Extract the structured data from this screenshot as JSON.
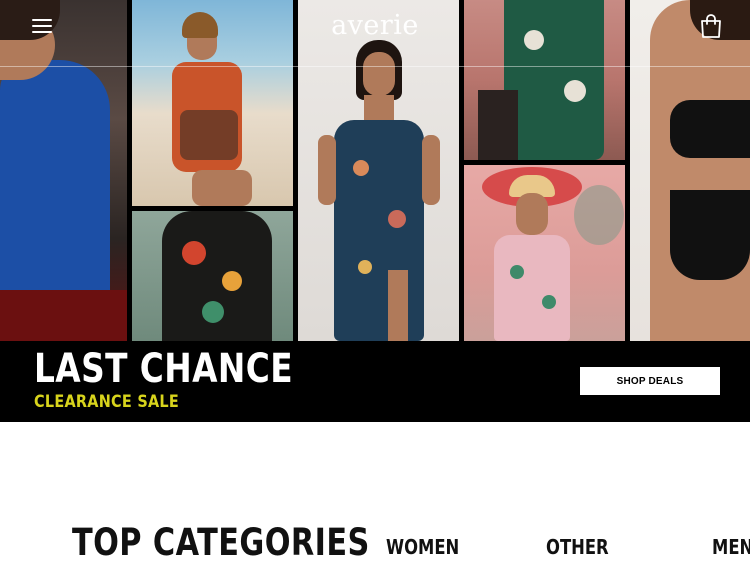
{
  "header": {
    "logo_text": "averie",
    "menu_icon": "hamburger-menu-icon",
    "bag_icon": "shopping-bag-icon"
  },
  "hero": {
    "title": "LAST CHANCE",
    "subtitle": "CLEARANCE SALE",
    "cta_label": "SHOP DEALS"
  },
  "categories": {
    "heading": "TOP CATEGORIES",
    "items": [
      "WOMEN",
      "OTHER",
      "MEN"
    ]
  },
  "colors": {
    "accent_yellow": "#d8d41c",
    "promo_bg": "#000000",
    "text_dark": "#111111",
    "white": "#ffffff"
  }
}
